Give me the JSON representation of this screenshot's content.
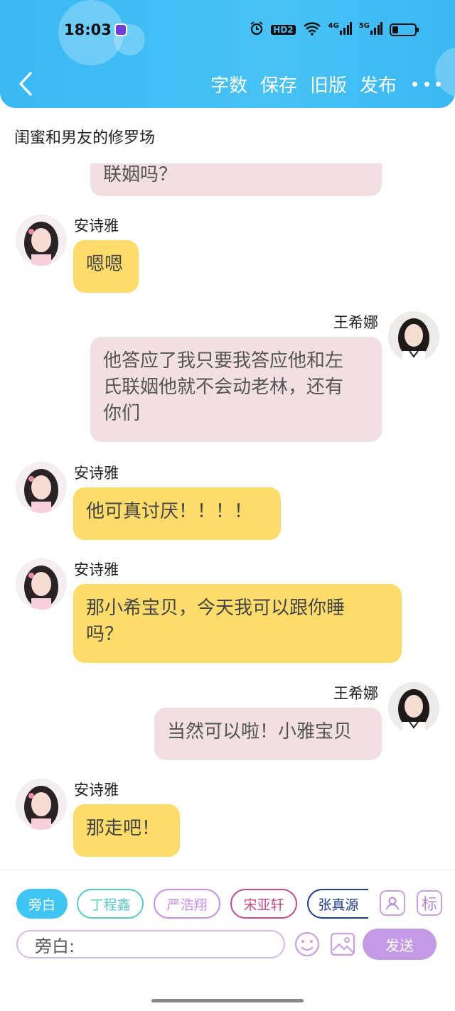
{
  "status_bar": {
    "time": "18:03",
    "hd": "HD2",
    "net1": "4G",
    "net2": "5G"
  },
  "header": {
    "actions": [
      "字数",
      "保存",
      "旧版",
      "发布"
    ]
  },
  "story_title": "闺蜜和男友的修罗场",
  "messages": [
    {
      "side": "right",
      "speaker": "",
      "text": "联姻吗？"
    },
    {
      "side": "left",
      "speaker": "安诗雅",
      "text": "嗯嗯"
    },
    {
      "side": "right",
      "speaker": "王希娜",
      "text_lines": [
        "他答应了我只要我答应他和左",
        "氏联姻他就不会动老林，还有",
        "你们"
      ]
    },
    {
      "side": "left",
      "speaker": "安诗雅",
      "text": "他可真讨厌！！！！"
    },
    {
      "side": "left",
      "speaker": "安诗雅",
      "text_lines": [
        "那小希宝贝，今天我可以跟你睡",
        "吗？"
      ]
    },
    {
      "side": "right",
      "speaker": "王希娜",
      "text": "当然可以啦！小雅宝贝"
    },
    {
      "side": "left",
      "speaker": "安诗雅",
      "text": "那走吧！"
    }
  ],
  "composer": {
    "chips": [
      {
        "label": "旁白",
        "color": "#3ec5f4",
        "filled": true
      },
      {
        "label": "丁程鑫",
        "color": "#5cc8c8",
        "filled": false
      },
      {
        "label": "严浩翔",
        "color": "#c88fe6",
        "filled": false
      },
      {
        "label": "宋亚轩",
        "color": "#c54a8a",
        "filled": false
      },
      {
        "label": "张真源",
        "color": "#1f3f8a",
        "filled": false
      }
    ],
    "mark_label": "标",
    "input_value": "旁白:",
    "send_label": "发送"
  },
  "colors": {
    "header_bg": "#40bdf4",
    "right_bubble": "#f1dfe1",
    "left_bubble": "#fddc6b",
    "accent_purple": "#c29ae5"
  }
}
